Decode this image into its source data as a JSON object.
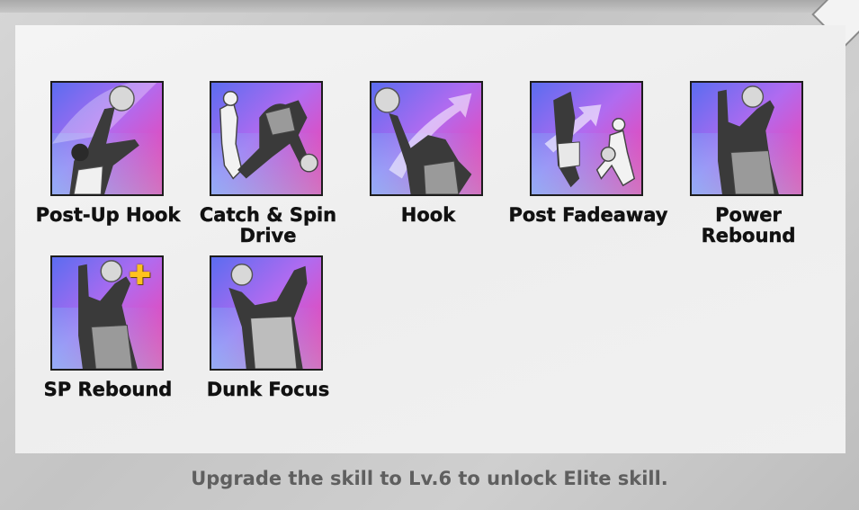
{
  "skills": [
    {
      "label": "Post-Up Hook",
      "icon": "post-up-hook-icon"
    },
    {
      "label": "Catch & Spin Drive",
      "icon": "catch-spin-drive-icon"
    },
    {
      "label": "Hook",
      "icon": "hook-icon"
    },
    {
      "label": "Post Fadeaway",
      "icon": "post-fadeaway-icon"
    },
    {
      "label": "Power Rebound",
      "icon": "power-rebound-icon"
    },
    {
      "label": "SP Rebound",
      "icon": "sp-rebound-icon",
      "badge": "plus-badge-icon"
    },
    {
      "label": "Dunk Focus",
      "icon": "dunk-focus-icon"
    }
  ],
  "footer": {
    "message": "Upgrade the skill to Lv.6 to unlock Elite skill."
  },
  "colors": {
    "card_gradient_start": "#5b6cf0",
    "card_gradient_end": "#ff3aa0",
    "badge": "#ffc21c",
    "footer_text": "#5f5f5f"
  }
}
